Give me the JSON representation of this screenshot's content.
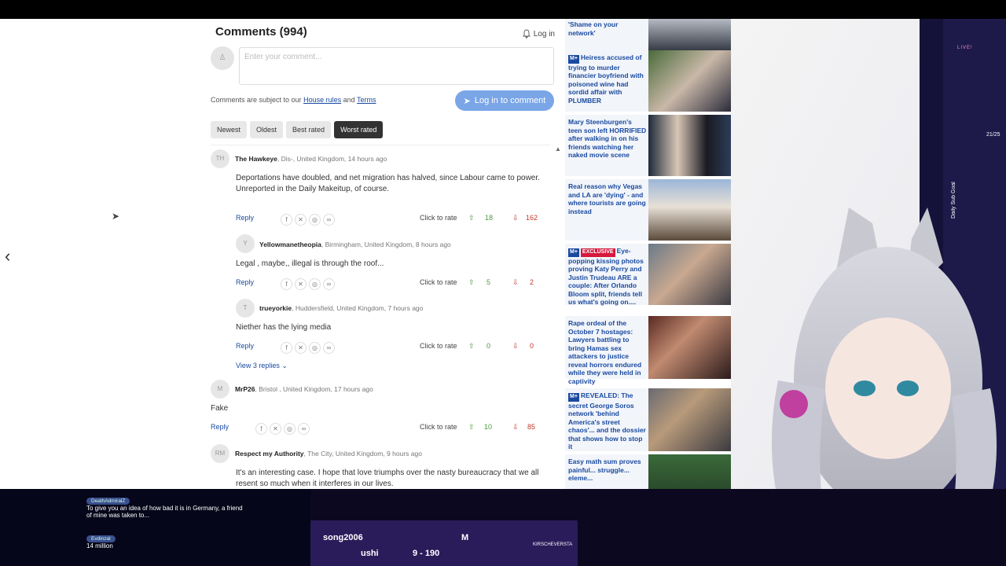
{
  "comments_section": {
    "title": "Comments (994)",
    "login_label": "Log in",
    "input_placeholder": "Enter your comment...",
    "terms_prefix": "Comments are subject to our",
    "house_rules": "House rules",
    "and": "and",
    "terms": "Terms",
    "login_button": "Log in to comment",
    "sort_options": [
      "Newest",
      "Oldest",
      "Best rated",
      "Worst rated"
    ],
    "active_sort": "Worst rated",
    "click_to_rate": "Click to rate",
    "reply": "Reply",
    "view_replies": "View 3 replies",
    "comments": [
      {
        "initials": "TH",
        "author": "The Hawkeye",
        "location": ", Dis-, United Kingdom, 14 hours ago",
        "text": "Deportations have doubled, and net migration has halved, since Labour came to power.\nUnreported in the Daily Makeitup, of course.",
        "up": "18",
        "down": "162"
      },
      {
        "initials": "Y",
        "author": "Yellowmanetheopia",
        "location": ", Birmingham, United Kingdom, 8 hours ago",
        "text": "Legal , maybe,, illegal is through the roof...",
        "up": "5",
        "down": "2"
      },
      {
        "initials": "T",
        "author": "trueyorkie",
        "location": ", Huddersfield, United Kingdom, 7 hours ago",
        "text": "Niether has the lying media",
        "up": "0",
        "down": "0"
      },
      {
        "initials": "M",
        "author": "MrP26",
        "location": ", Bristol , United Kingdom, 17 hours ago",
        "text": "Fake",
        "up": "10",
        "down": "85"
      },
      {
        "initials": "RM",
        "author": "Respect my Authority",
        "location": ", The City, United Kingdom, 9 hours ago",
        "text": "It's an interesting case. I hope that love triumphs over the nasty bureaucracy that we all resent so much when it interferes in our lives."
      }
    ]
  },
  "rail": {
    "stories": [
      {
        "text": "'Shame on your network'",
        "badge": ""
      },
      {
        "text": "Heiress accused of trying to murder financier boyfriend with poisoned wine had sordid affair with PLUMBER",
        "badge": "plus"
      },
      {
        "text": "Mary Steenburgen's teen son left HORRIFIED after walking in on his friends watching her naked movie scene",
        "badge": ""
      },
      {
        "text": "Real reason why Vegas and LA are 'dying' - and where tourists are going instead",
        "badge": ""
      },
      {
        "text": "Eye-popping kissing photos proving Katy Perry and Justin Trudeau ARE a couple: After Orlando Bloom split, friends tell us what's going on....",
        "badge": "exclusive",
        "badge_text": "EXCLUSIVE"
      },
      {
        "text": "Rape ordeal of the October 7 hostages: Lawyers battling to bring Hamas sex attackers to justice reveal horrors endured while they were held in captivity",
        "badge": ""
      },
      {
        "text": "REVEALED: The secret George Soros network 'behind America's street chaos'... and the dossier that shows how to stop it",
        "badge": "plus"
      },
      {
        "text": "Easy math sum proves painful... struggle... eleme...",
        "badge": ""
      }
    ],
    "plus_label": "M+"
  },
  "stream": {
    "chat": [
      {
        "name": "DeathAdmiralZ",
        "text": "To give you an idea of how bad it is in Germany, a friend of mine was taken to..."
      },
      {
        "name": "Evdinzal",
        "text": "14 million"
      }
    ],
    "ticker1": "song2006",
    "ticker2": "ushi",
    "ticker_value": "9 - 190",
    "ticker_m": "M",
    "kirsch": "KIRSCHEVERSTA",
    "goal_label": "Daily Sub Goal",
    "goal_count": "21/25",
    "live": "LIVE!"
  }
}
